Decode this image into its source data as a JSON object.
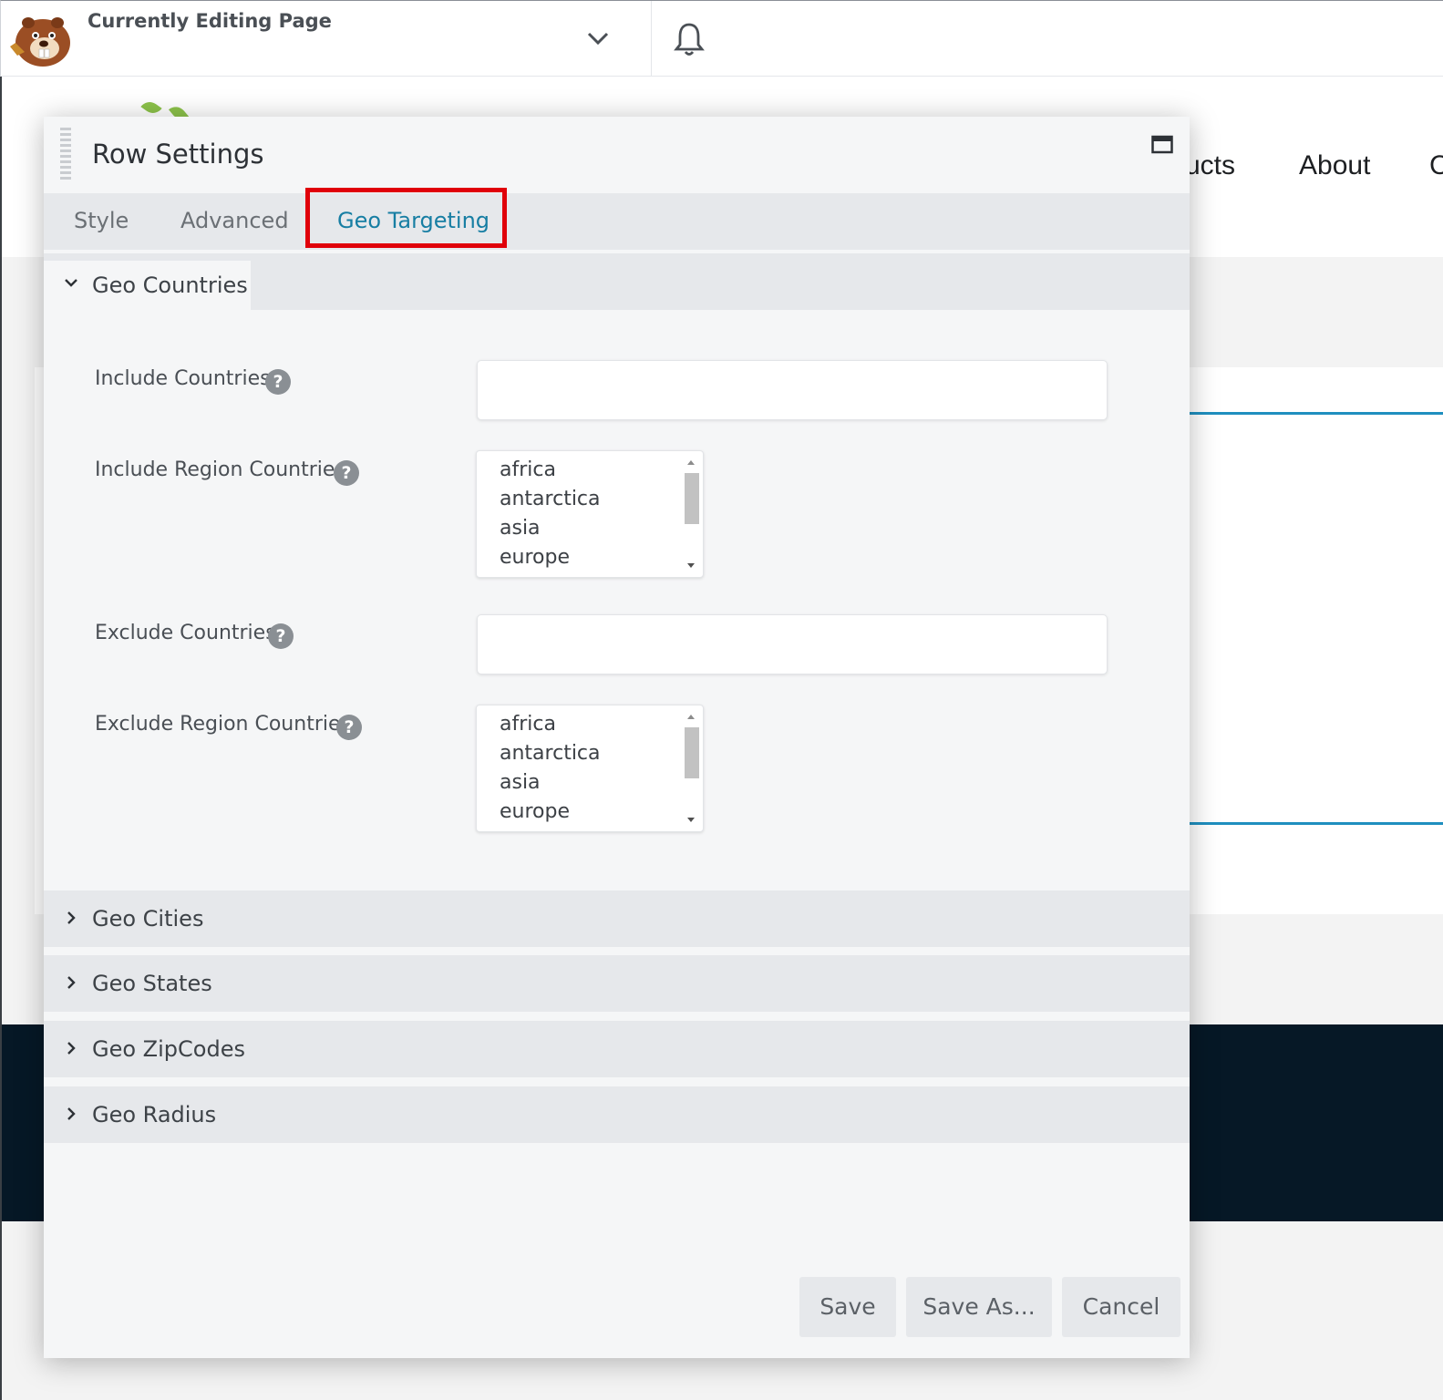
{
  "topbar": {
    "title": "Currently Editing Page",
    "logo_icon": "beaver-logo-icon",
    "dropdown_icon": "chevron-down-icon",
    "notifications_icon": "bell-icon"
  },
  "background_page": {
    "nav": [
      "ucts",
      "About",
      "C"
    ]
  },
  "modal": {
    "title": "Row Settings",
    "maximize_icon": "window-maximize-icon",
    "tabs": [
      {
        "label": "Style",
        "active": false
      },
      {
        "label": "Advanced",
        "active": false
      },
      {
        "label": "Geo Targeting",
        "active": true
      }
    ],
    "open_section": {
      "label": "Geo Countries",
      "fields": [
        {
          "label": "Include Countries",
          "type": "text",
          "value": ""
        },
        {
          "label": "Include Region Countries",
          "type": "multiselect",
          "options": [
            "africa",
            "antarctica",
            "asia",
            "europe"
          ]
        },
        {
          "label": "Exclude Countries",
          "type": "text",
          "value": ""
        },
        {
          "label": "Exclude Region Countries",
          "type": "multiselect",
          "options": [
            "africa",
            "antarctica",
            "asia",
            "europe"
          ]
        }
      ]
    },
    "collapsed_sections": [
      "Geo Cities",
      "Geo States",
      "Geo ZipCodes",
      "Geo Radius"
    ],
    "buttons": {
      "save": "Save",
      "save_as": "Save As...",
      "cancel": "Cancel"
    },
    "help_glyph": "?"
  },
  "colors": {
    "accent": "#177ea3",
    "highlight": "#e0000a",
    "footer_dark": "#061826"
  }
}
